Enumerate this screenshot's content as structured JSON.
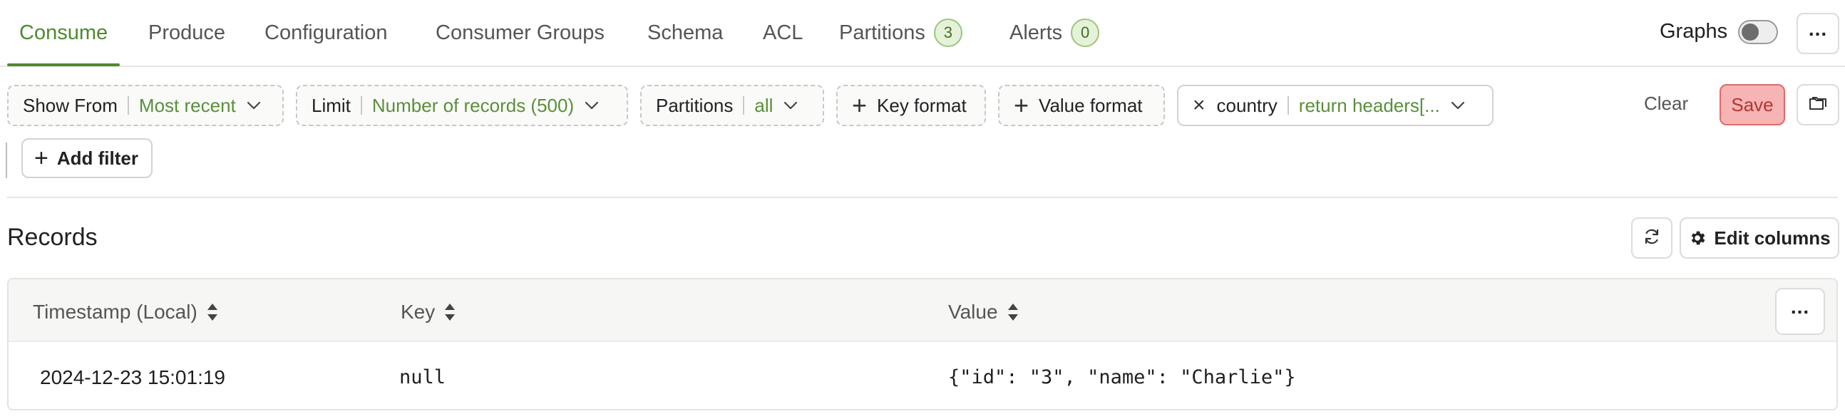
{
  "tabs": [
    {
      "label": "Consume",
      "active": true
    },
    {
      "label": "Produce"
    },
    {
      "label": "Configuration"
    },
    {
      "label": "Consumer Groups"
    },
    {
      "label": "Schema"
    },
    {
      "label": "ACL"
    },
    {
      "label": "Partitions",
      "badge": "3"
    },
    {
      "label": "Alerts",
      "badge": "0"
    }
  ],
  "header": {
    "graphs_label": "Graphs",
    "graphs_enabled": false,
    "more_icon": "more-horizontal-icon"
  },
  "filters": {
    "show_from": {
      "label": "Show From",
      "value": "Most recent"
    },
    "limit": {
      "label": "Limit",
      "value": "Number of records (500)"
    },
    "partitions": {
      "label": "Partitions",
      "value": "all"
    },
    "key_format": {
      "label": "Key format"
    },
    "value_format": {
      "label": "Value format"
    },
    "header_filter": {
      "label": "country",
      "value": "return headers[..."
    },
    "add_filter_label": "Add filter",
    "clear_label": "Clear",
    "save_label": "Save"
  },
  "records": {
    "title": "Records",
    "edit_columns_label": "Edit columns",
    "columns": [
      "Timestamp (Local)",
      "Key",
      "Value"
    ],
    "rows": [
      {
        "timestamp": "2024-12-23 15:01:19",
        "key": "null",
        "value": "{\"id\": \"3\", \"name\": \"Charlie\"}"
      }
    ]
  },
  "colors": {
    "accent": "#4e8a2e",
    "value_text": "#5a8f3a",
    "save_bg": "#f6b4b4",
    "save_border": "#e06a6a"
  }
}
